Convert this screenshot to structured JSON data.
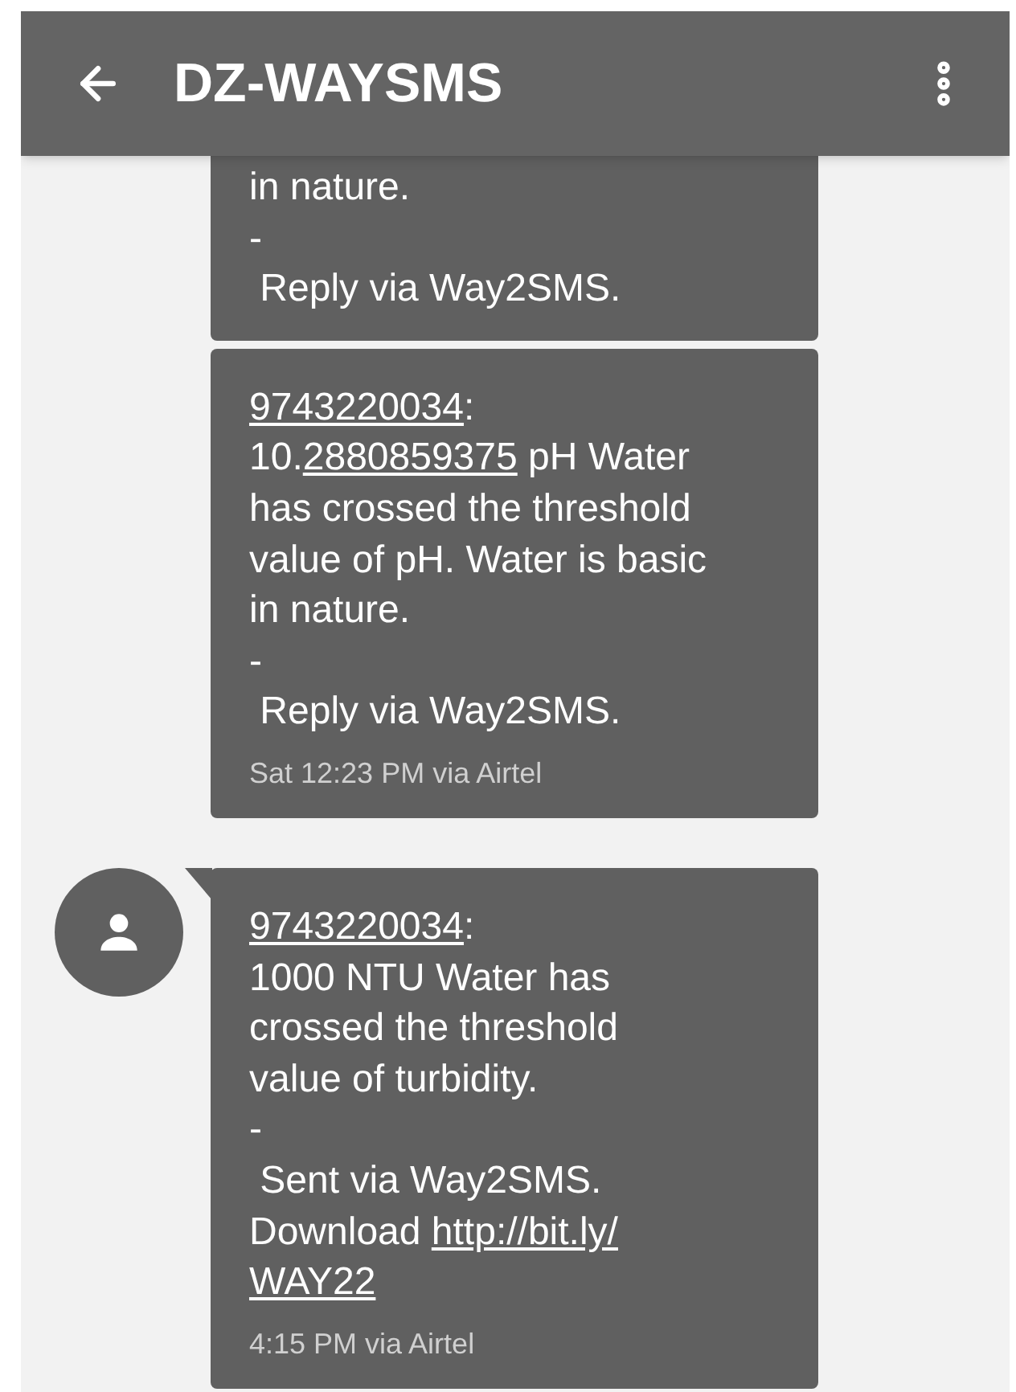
{
  "header": {
    "title": "DZ-WAYSMS"
  },
  "messages": [
    {
      "show_avatar": false,
      "lines": [
        [
          {
            "kind": "plain",
            "text": "in nature."
          }
        ],
        [
          {
            "kind": "plain",
            "text": "-"
          }
        ],
        [
          {
            "kind": "plain",
            "text": " Reply via Way2SMS."
          }
        ]
      ]
    },
    {
      "show_avatar": false,
      "time": "Sat 12:23 PM via Airtel",
      "lines": [
        [
          {
            "kind": "phone",
            "text": "9743220034"
          },
          {
            "kind": "plain",
            "text": ":"
          }
        ],
        [
          {
            "kind": "plain",
            "text": "10."
          },
          {
            "kind": "phone",
            "text": "2880859375"
          },
          {
            "kind": "plain",
            "text": " pH Water"
          }
        ],
        [
          {
            "kind": "plain",
            "text": "has crossed the threshold"
          }
        ],
        [
          {
            "kind": "plain",
            "text": "value of pH. Water is basic"
          }
        ],
        [
          {
            "kind": "plain",
            "text": "in nature."
          }
        ],
        [
          {
            "kind": "plain",
            "text": "-"
          }
        ],
        [
          {
            "kind": "plain",
            "text": " Reply via Way2SMS."
          }
        ]
      ]
    },
    {
      "show_avatar": true,
      "time": "4:15 PM via Airtel",
      "lines": [
        [
          {
            "kind": "phone",
            "text": "9743220034"
          },
          {
            "kind": "plain",
            "text": ":"
          }
        ],
        [
          {
            "kind": "plain",
            "text": "1000 NTU Water has"
          }
        ],
        [
          {
            "kind": "plain",
            "text": "crossed the threshold"
          }
        ],
        [
          {
            "kind": "plain",
            "text": "value of turbidity."
          }
        ],
        [
          {
            "kind": "plain",
            "text": "-"
          }
        ],
        [
          {
            "kind": "plain",
            "text": " Sent via Way2SMS."
          }
        ],
        [
          {
            "kind": "plain",
            "text": "Download "
          },
          {
            "kind": "url",
            "text": "http://bit.ly/"
          }
        ],
        [
          {
            "kind": "url",
            "text": "WAY22"
          }
        ]
      ]
    }
  ]
}
